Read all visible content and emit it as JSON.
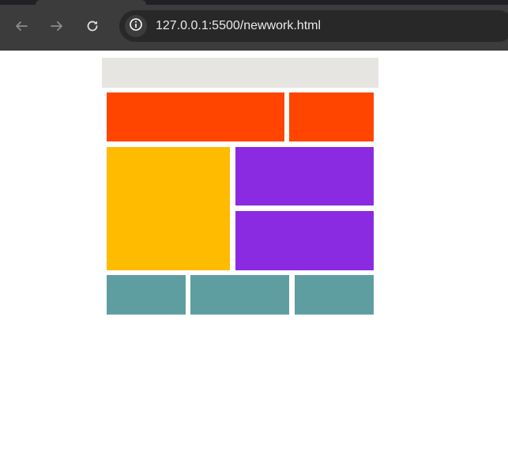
{
  "browser": {
    "url": "127.0.0.1:5500/newwork.html",
    "icons": {
      "back": "arrow-left-icon",
      "forward": "arrow-right-icon",
      "reload": "reload-icon",
      "site_info": "info-icon"
    }
  },
  "page": {
    "blocks": {
      "header": "#e6e5e1",
      "red": "#ff4500",
      "yellow": "#ffbb00",
      "purple": "#8a2be2",
      "teal": "#5f9ea0"
    }
  }
}
